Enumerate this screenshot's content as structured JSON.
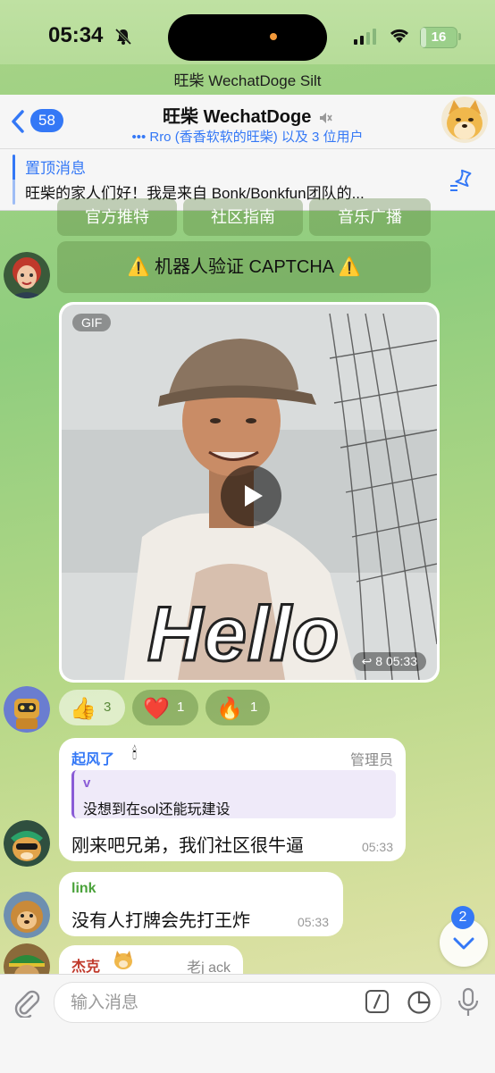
{
  "status": {
    "time": "05:34",
    "battery": "16",
    "battery_level": 0.16,
    "colors": {
      "accent": "#3478f6"
    }
  },
  "chat_caption": "旺柴 WechatDoge Silt",
  "header": {
    "back_badge": "58",
    "title": "旺柴 WechatDoge",
    "subtitle": "••• Rro (香香软软的旺柴) 以及 3 位用户",
    "icons": [
      "chevron-left-icon",
      "mute-icon",
      "doge-avatar"
    ]
  },
  "pinned": {
    "title": "置顶消息",
    "text": "旺柴的家人们好！我是来自 Bonk/Bonkfun团队的..."
  },
  "keyboard": {
    "buttons": [
      "官方推特",
      "社区指南",
      "音乐广播"
    ],
    "captcha": "⚠️ 机器人验证 CAPTCHA ⚠️"
  },
  "gif_message": {
    "label": "GIF",
    "overlay_text": "Hello",
    "meta": "↩ 8  05:33"
  },
  "reactions": [
    {
      "emoji": "👍",
      "count": "3"
    },
    {
      "emoji": "❤️",
      "count": "1"
    },
    {
      "emoji": "🔥",
      "count": "1"
    }
  ],
  "messages": [
    {
      "sender": "起风了",
      "sender_badge": "🕯",
      "role": "管理员",
      "reply_name": "v",
      "reply_text": "没想到在sol还能玩建设",
      "text": "刚来吧兄弟，我们社区很牛逼",
      "time": "05:33"
    },
    {
      "sender": "link",
      "text": "没有人打牌会先打王炸",
      "time": "05:33"
    },
    {
      "sender": "杰克",
      "role": "老j ack"
    }
  ],
  "scroll_badge": "2",
  "input": {
    "placeholder": "输入消息"
  }
}
